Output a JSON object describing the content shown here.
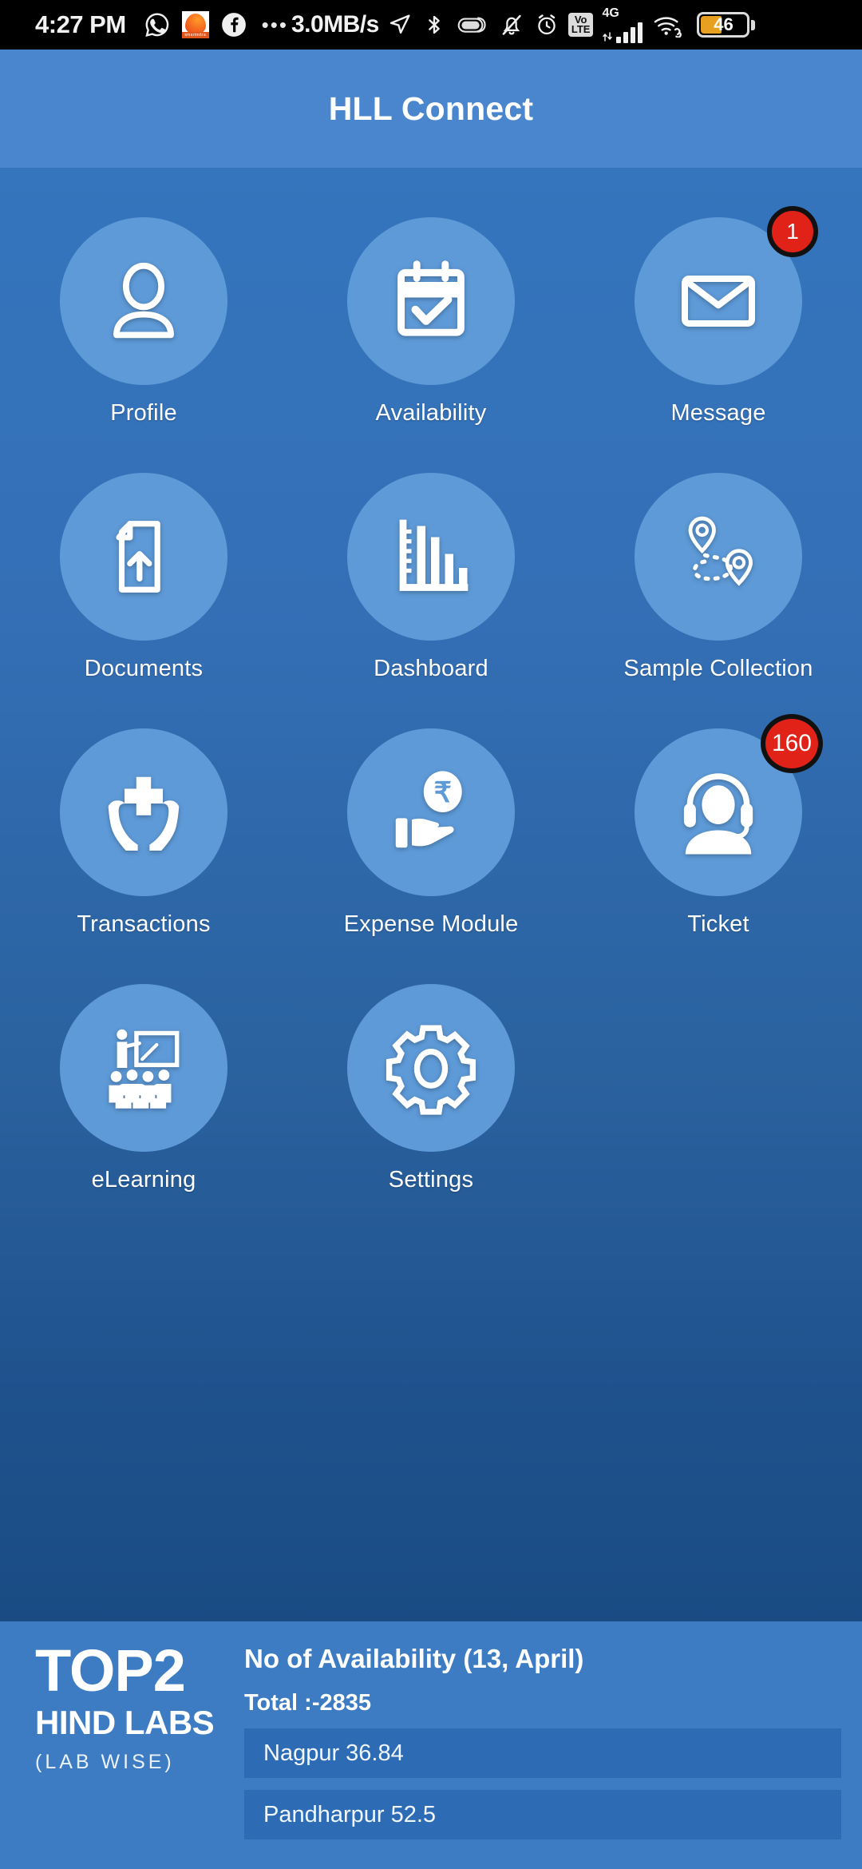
{
  "statusbar": {
    "clock": "4:27 PM",
    "network_speed": "3.0MB/s",
    "dots": "•••",
    "volte_top": "Vo",
    "volte_bottom": "LTE",
    "network_type": "4G",
    "battery_percent": "46",
    "icons": [
      "whatsapp-icon",
      "orange-app-icon",
      "facebook-icon",
      "location-arrow-icon",
      "bluetooth-icon",
      "capsule-icon",
      "mute-bell-icon",
      "alarm-icon",
      "volte-icon",
      "signal-bars-icon",
      "wifi-icon",
      "battery-icon"
    ],
    "orange_app_caption": "smartmitra"
  },
  "appbar": {
    "title": "HLL Connect"
  },
  "grid": {
    "tiles": [
      {
        "label": "Profile",
        "icon": "person-icon",
        "badge": null
      },
      {
        "label": "Availability",
        "icon": "calendar-check-icon",
        "badge": null
      },
      {
        "label": "Message",
        "icon": "envelope-icon",
        "badge": "1"
      },
      {
        "label": "Documents",
        "icon": "document-upload-icon",
        "badge": null
      },
      {
        "label": "Dashboard",
        "icon": "bar-chart-icon",
        "badge": null
      },
      {
        "label": "Sample Collection",
        "icon": "route-pins-icon",
        "badge": null
      },
      {
        "label": "Transactions",
        "icon": "hands-cross-icon",
        "badge": null
      },
      {
        "label": "Expense Module",
        "icon": "hand-rupee-icon",
        "badge": null
      },
      {
        "label": "Ticket",
        "icon": "headset-agent-icon",
        "badge": "160"
      },
      {
        "label": "eLearning",
        "icon": "classroom-icon",
        "badge": null
      },
      {
        "label": "Settings",
        "icon": "gear-icon",
        "badge": null
      }
    ]
  },
  "bottom_panel": {
    "logo_line1": "TOP2",
    "logo_line2": "HIND LABS",
    "logo_line3": "(LAB WISE)",
    "availability_title": "No of Availability (13, April)",
    "total_label": "Total :-2835",
    "rows": [
      {
        "text": "Nagpur 36.84"
      },
      {
        "text": "Pandharpur 52.5"
      }
    ]
  },
  "colors": {
    "appbar_blue": "#4a86ce",
    "body_blue_top": "#3475bd",
    "body_blue_bottom": "#1a4b83",
    "circle_blue": "#5e9ad8",
    "panel_blue": "#3d7cc3",
    "row_blue": "#2d6cb5",
    "badge_red": "#e02218",
    "battery_orange": "#e8a020"
  },
  "chart_data": {
    "type": "bar",
    "title": "No of Availability (13, April)",
    "subtitle": "TOP2 HIND LABS (LAB WISE)",
    "categories": [
      "Nagpur",
      "Pandharpur"
    ],
    "values": [
      36.84,
      52.5
    ],
    "total": 2835,
    "xlabel": "",
    "ylabel": "",
    "legend": "none"
  }
}
